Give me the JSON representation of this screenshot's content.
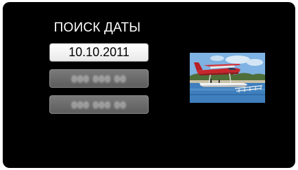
{
  "screen": {
    "title": "ПОИСК ДАТЫ"
  },
  "date_list": [
    {
      "label": "10.10.2011",
      "selected": true
    },
    {
      "label": "000 000 00",
      "selected": false,
      "obscured": true
    },
    {
      "label": "000 000 00",
      "selected": false,
      "obscured": true
    }
  ],
  "thumbnail": {
    "icon": "seaplane-photo-thumbnail"
  },
  "colors": {
    "background": "#000000",
    "selected_button": "#ffffff",
    "unselected_button": "#6b6b6b",
    "title_text": "#ffffff"
  }
}
